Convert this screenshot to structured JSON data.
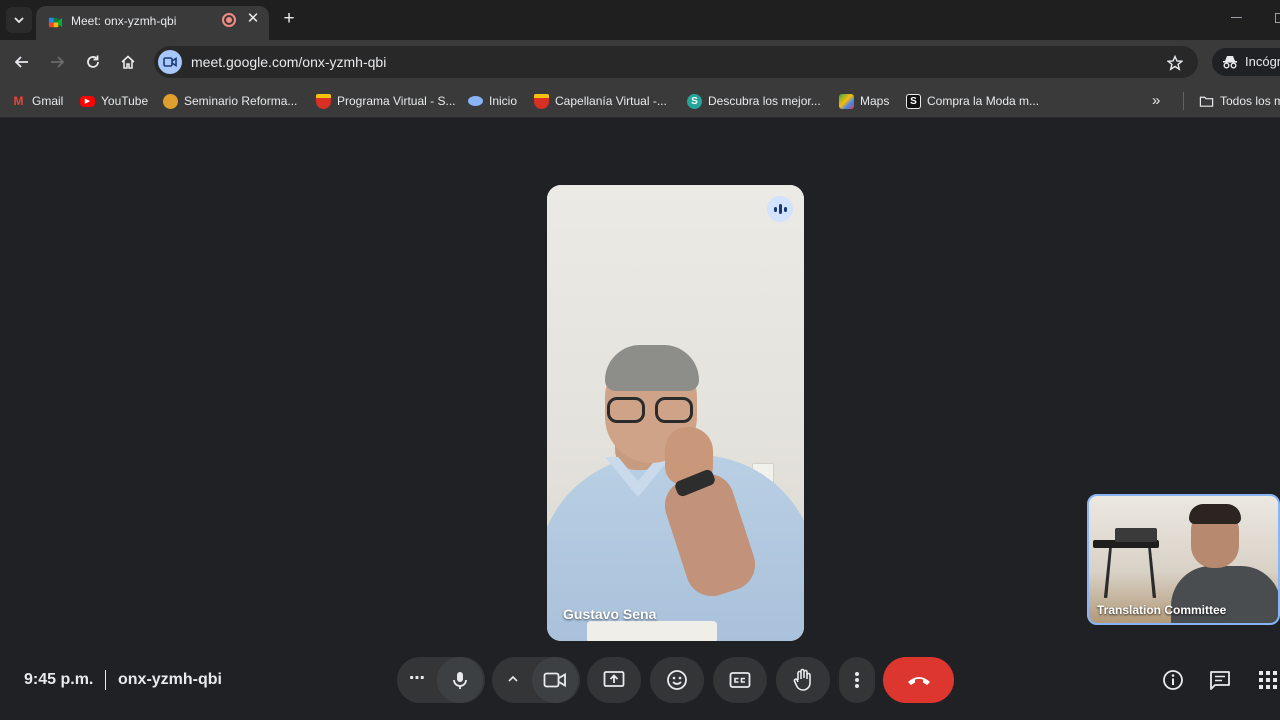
{
  "browser": {
    "tab_title": "Meet: onx-yzmh-qbi",
    "url": "meet.google.com/onx-yzmh-qbi",
    "incognito_label": "Incógn"
  },
  "bookmarks": [
    {
      "label": "Gmail",
      "icon": "gmail-icon",
      "color": "#ea4335"
    },
    {
      "label": "YouTube",
      "icon": "youtube-icon",
      "color": "#ff0000"
    },
    {
      "label": "Seminario Reforma...",
      "icon": "seminario-icon",
      "color": "#e0a030"
    },
    {
      "label": "Programa Virtual - S...",
      "icon": "shield-icon",
      "color": "#d93025"
    },
    {
      "label": "Inicio",
      "icon": "inicio-icon",
      "color": "#8ab4f8"
    },
    {
      "label": "Capellanía Virtual -...",
      "icon": "shield-icon",
      "color": "#d93025"
    },
    {
      "label": "Descubra los mejor...",
      "icon": "s-globe-icon",
      "color": "#26a69a"
    },
    {
      "label": "Maps",
      "icon": "maps-icon",
      "color": "#34a853"
    },
    {
      "label": "Compra la Moda m...",
      "icon": "s-letter-icon",
      "color": "#111111"
    },
    {
      "label": "Todos los m",
      "icon": "folder-icon",
      "color": "#e8eaed"
    }
  ],
  "meet": {
    "main_participant": "Gustavo Sena",
    "self_participant": "Translation Committee",
    "clock": "9:45 p.m.",
    "meeting_code": "onx-yzmh-qbi",
    "more_label": "⋯"
  },
  "colors": {
    "accent": "#8ab4f8",
    "hangup": "#dc362e",
    "background": "#202124"
  }
}
